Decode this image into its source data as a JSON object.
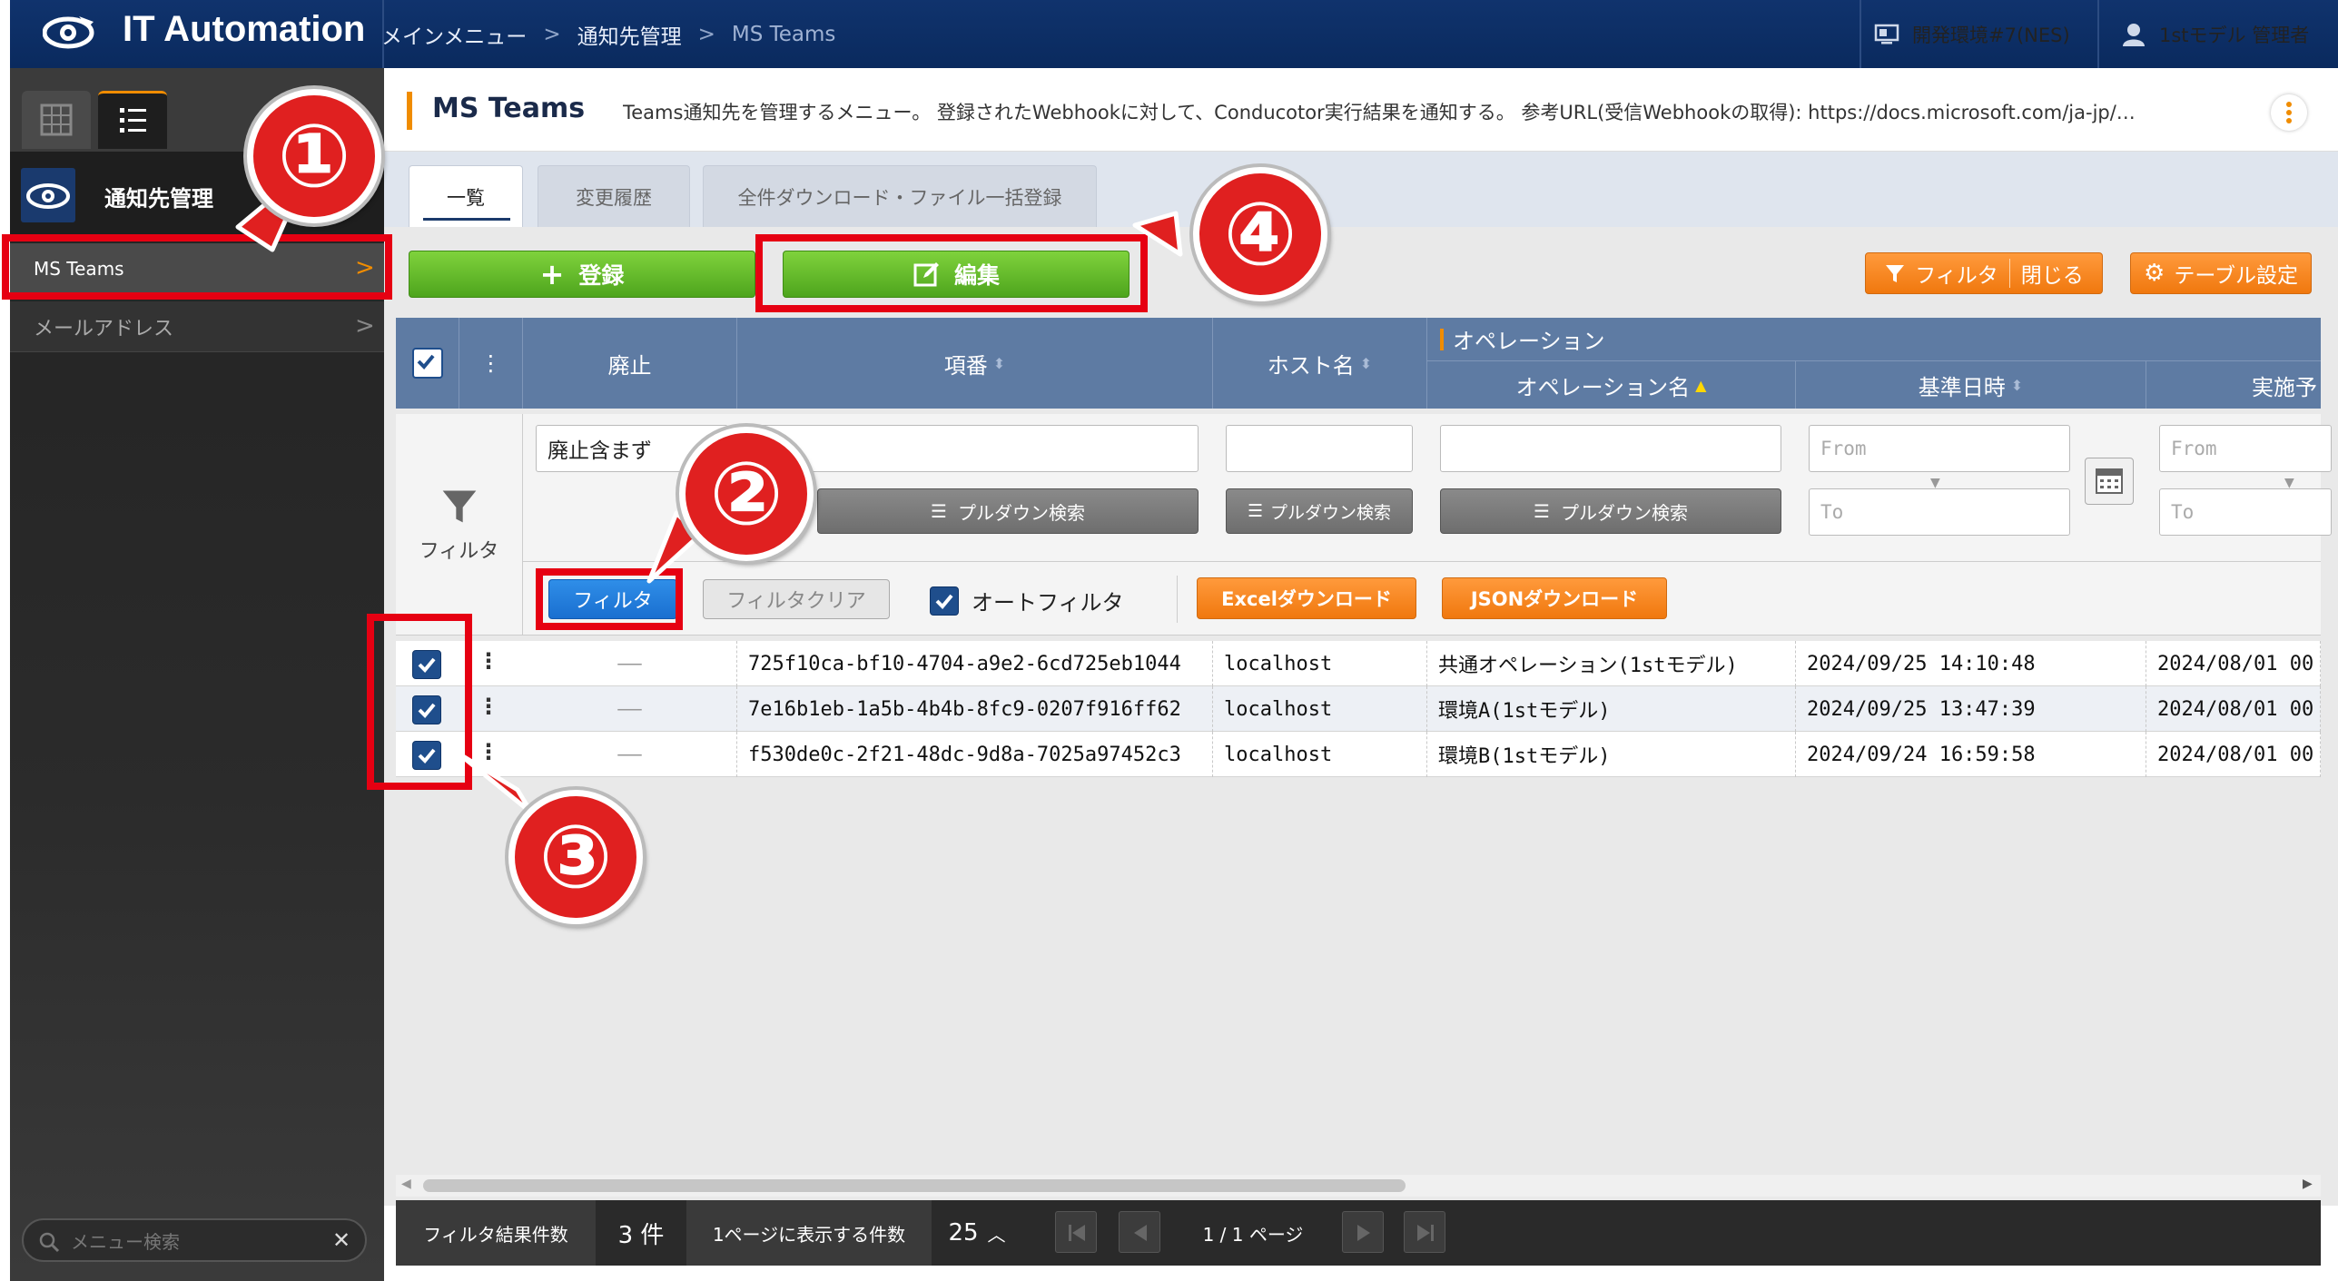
{
  "app": {
    "title": "IT Automation"
  },
  "breadcrumb": {
    "items": [
      "メインメニュー",
      "通知先管理",
      "MS Teams"
    ]
  },
  "header": {
    "environment": "開発環境#7(NES)",
    "user": "1stモデル 管理者"
  },
  "sidebar": {
    "menu_group": "通知先管理",
    "items": [
      {
        "label": "MS Teams"
      },
      {
        "label": "メールアドレス"
      }
    ],
    "search_placeholder": "メニュー検索"
  },
  "page": {
    "title": "MS Teams",
    "description": "Teams通知先を管理するメニュー。 登録されたWebhookに対して、Conducotor実行結果を通知する。 参考URL(受信Webhookの取得): https://docs.microsoft.com/ja-jp/…"
  },
  "tabs": [
    "一覧",
    "変更履歴",
    "全件ダウンロード・ファイル一括登録"
  ],
  "toolbar": {
    "register": "登録",
    "edit": "編集",
    "filter": "フィルタ",
    "close": "閉じる",
    "table_settings": "テーブル設定"
  },
  "table": {
    "headers": {
      "discard": "廃止",
      "item_no": "項番",
      "host": "ホスト名",
      "operation_group": "オペレーション",
      "operation_name": "オペレーション名",
      "base_datetime": "基準日時",
      "scheduled": "実施予"
    },
    "filter": {
      "label": "フィルタ",
      "discard_value": "廃止含まず",
      "pulldown": "プルダウン検索",
      "from": "From",
      "to": "To",
      "filter_button": "フィルタ",
      "clear_button": "フィルタクリア",
      "auto_filter": "オートフィルタ",
      "excel_download": "Excelダウンロード",
      "json_download": "JSONダウンロード"
    },
    "rows": [
      {
        "discard": "——",
        "item_no": "725f10ca-bf10-4704-a9e2-6cd725eb1044",
        "host": "localhost",
        "operation": "共通オペレーション(1stモデル)",
        "base": "2024/09/25 14:10:48",
        "scheduled": "2024/08/01 00"
      },
      {
        "discard": "——",
        "item_no": "7e16b1eb-1a5b-4b4b-8fc9-0207f916ff62",
        "host": "localhost",
        "operation": "環境A(1stモデル)",
        "base": "2024/09/25 13:47:39",
        "scheduled": "2024/08/01 00"
      },
      {
        "discard": "——",
        "item_no": "f530de0c-2f21-48dc-9d8a-7025a97452c3",
        "host": "localhost",
        "operation": "環境B(1stモデル)",
        "base": "2024/09/24 16:59:58",
        "scheduled": "2024/08/01 00"
      }
    ]
  },
  "footer": {
    "filter_result_label": "フィルタ結果件数",
    "filter_result_count": "3 件",
    "per_page_label": "1ページに表示する件数",
    "per_page_value": "25",
    "page_info": "1 / 1 ページ"
  },
  "annotations": [
    "①",
    "②",
    "③",
    "④"
  ],
  "colors": {
    "header": "#0a2a5e",
    "accent": "#f08c00",
    "annotation": "#e60012",
    "green": "#4ea51d"
  }
}
